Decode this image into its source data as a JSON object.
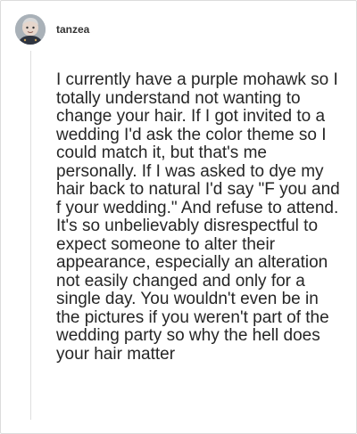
{
  "comment": {
    "username": "tanzea",
    "text": "I currently have a purple mohawk so I totally understand not wanting to change your hair. If I got invited to a wedding I'd ask the color theme so I could match it, but that's me personally. If I was asked to dye my hair back to natural I'd say \"F you and f your wedding.\" And refuse to attend. It's so unbelievably disrespectful to expect someone to alter their appearance, especially an alteration not easily changed and only for a single day. You wouldn't even be in the pictures if you weren't part of the wedding party so why the hell does your hair matter"
  },
  "icons": {
    "avatar": "user-avatar-photo"
  },
  "colors": {
    "text": "#262626",
    "username": "#333333",
    "border": "#dcdcdc",
    "thread_line": "#dedede"
  }
}
